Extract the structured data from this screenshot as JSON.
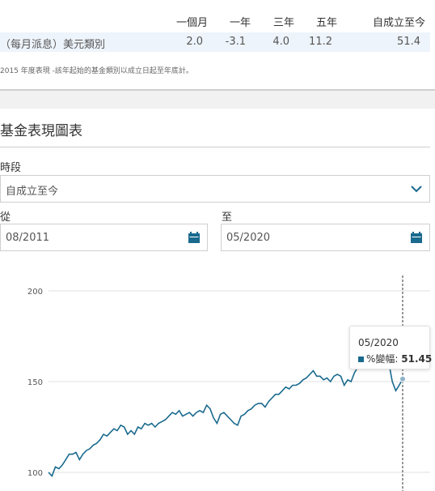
{
  "performance_table": {
    "headers": [
      "一個月",
      "一年",
      "三年",
      "五年",
      "自成立至今"
    ],
    "row": {
      "name": "（每月派息）美元類別",
      "values": [
        "2.0",
        "-3.1",
        "4.0",
        "11.2",
        "51.4"
      ]
    },
    "note": "2015 年度表現 -該年起始的基金類別以成立日起至年底計。"
  },
  "chart_section": {
    "title": "基金表現圖表",
    "period_label": "時段",
    "period_value": "自成立至今",
    "from_label": "從",
    "from_value": "08/2011",
    "to_label": "至",
    "to_value": "05/2020"
  },
  "icons": {
    "period_dropdown": "chevron-down-icon",
    "from_picker": "calendar-icon",
    "to_picker": "calendar-icon"
  },
  "colors": {
    "series": "#1a6a8e",
    "row_highlight": "#eef4fb",
    "accent": "#1a6a8e"
  },
  "tooltip": {
    "date": "05/2020",
    "label": "%變幅:",
    "value": "51.45"
  },
  "chart_data": {
    "type": "line",
    "title": "",
    "xlabel": "",
    "ylabel": "",
    "yticks": [
      "200",
      "150",
      "100"
    ],
    "ylim": [
      95,
      205
    ],
    "grid": true,
    "x_range": [
      "08/2011",
      "05/2020"
    ],
    "series": [
      {
        "name": "%變幅",
        "values": [
          100,
          98,
          103,
          102,
          104,
          107,
          110,
          110,
          111,
          107,
          110,
          112,
          113,
          115,
          116,
          118,
          121,
          120,
          122,
          124,
          123,
          126,
          125,
          121,
          123,
          121,
          125,
          124,
          127,
          126,
          127,
          125,
          127,
          128,
          129,
          131,
          133,
          132,
          134,
          131,
          132,
          133,
          131,
          133,
          134,
          133,
          137,
          135,
          130,
          127,
          132,
          133,
          131,
          129,
          127,
          126,
          131,
          132,
          134,
          135,
          137,
          138,
          138,
          136,
          139,
          141,
          143,
          143,
          145,
          147,
          146,
          148,
          148,
          149,
          151,
          152,
          154,
          156,
          153,
          153,
          151,
          152,
          150,
          153,
          154,
          153,
          148,
          151,
          150,
          155,
          158,
          159,
          161,
          161,
          163,
          163,
          164,
          165,
          162,
          160,
          150,
          145,
          148,
          151.45
        ]
      }
    ]
  }
}
